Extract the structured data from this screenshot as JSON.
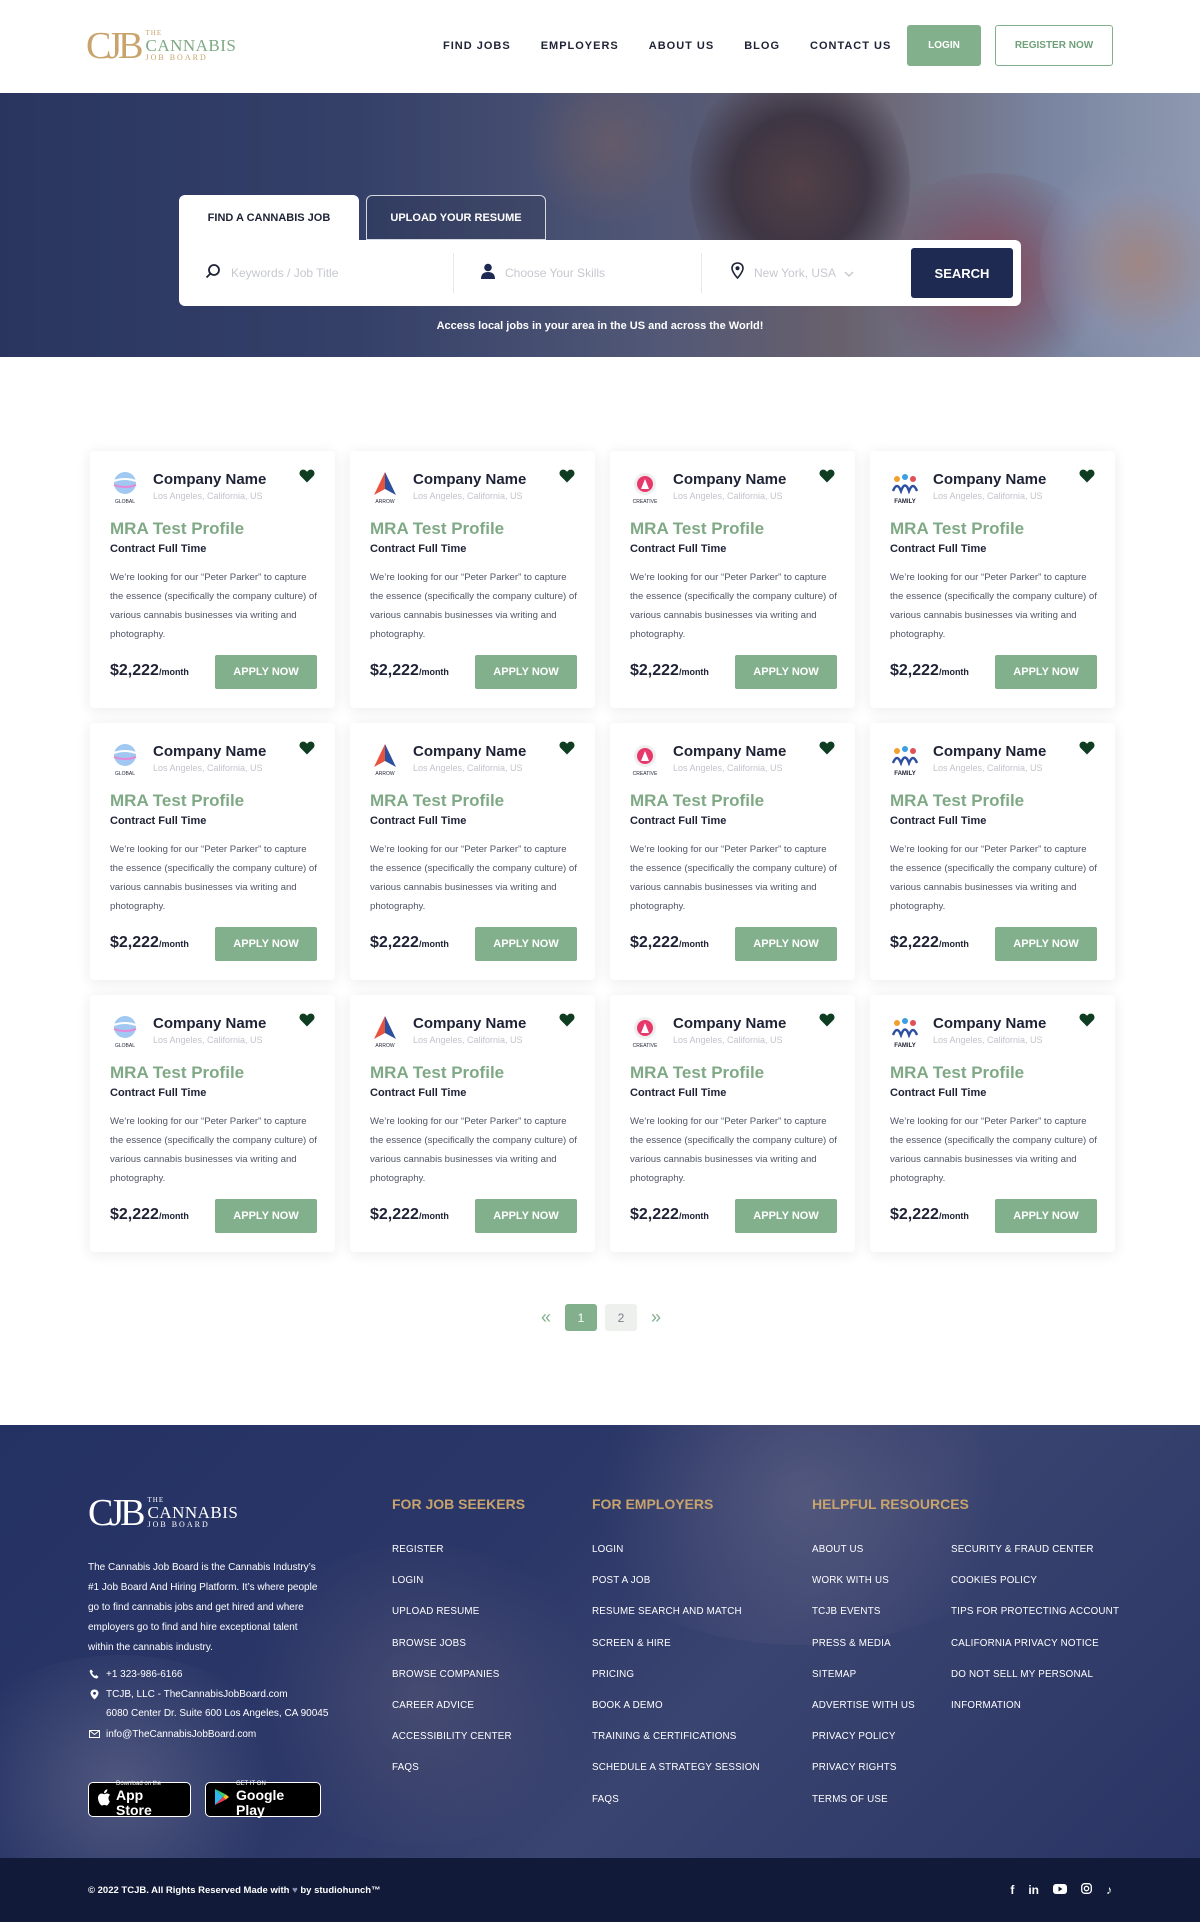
{
  "brand": {
    "mark": "CJB",
    "the": "THE",
    "name": "CANNABIS",
    "sub": "JOB BOARD"
  },
  "nav": {
    "items": [
      {
        "label": "FIND JOBS"
      },
      {
        "label": "EMPLOYERS"
      },
      {
        "label": "ABOUT US"
      },
      {
        "label": "BLOG"
      },
      {
        "label": "CONTACT US"
      }
    ],
    "login": "LOGIN",
    "register": "REGISTER NOW"
  },
  "hero": {
    "tabs": {
      "find": "FIND A CANNABIS JOB",
      "upload": "UPLOAD YOUR RESUME"
    },
    "search": {
      "keywords_placeholder": "Keywords / Job Title",
      "skills_placeholder": "Choose Your Skills",
      "location_placeholder": "New York, USA",
      "button": "SEARCH"
    },
    "caption": "Access local jobs in your area in the US and across the World!"
  },
  "jobs": [
    {
      "company": "Company Name",
      "location": "Los Angeles, California, US",
      "logo": "GLOBAL",
      "title": "MRA Test Profile",
      "type": "Contract Full Time",
      "desc": "We’re looking for our “Peter Parker” to capture the essence (specifically the company culture) of various cannabis businesses via writing and photography.",
      "price": "$2,222",
      "per": "/month",
      "apply": "APPLY NOW"
    },
    {
      "company": "Company Name",
      "location": "Los Angeles, California, US",
      "logo": "ARROW",
      "title": "MRA Test Profile",
      "type": "Contract Full Time",
      "desc": "We’re looking for our “Peter Parker” to capture the essence (specifically the company culture) of various cannabis businesses via writing and photography.",
      "price": "$2,222",
      "per": "/month",
      "apply": "APPLY NOW"
    },
    {
      "company": "Company Name",
      "location": "Los Angeles, California, US",
      "logo": "CREATIVE",
      "title": "MRA Test Profile",
      "type": "Contract Full Time",
      "desc": "We’re looking for our “Peter Parker” to capture the essence (specifically the company culture) of various cannabis businesses via writing and photography.",
      "price": "$2,222",
      "per": "/month",
      "apply": "APPLY NOW"
    },
    {
      "company": "Company Name",
      "location": "Los Angeles, California, US",
      "logo": "FAMILY",
      "title": "MRA Test Profile",
      "type": "Contract Full Time",
      "desc": "We’re looking for our “Peter Parker” to capture the essence (specifically the company culture) of various cannabis businesses via writing and photography.",
      "price": "$2,222",
      "per": "/month",
      "apply": "APPLY NOW"
    },
    {
      "company": "Company Name",
      "location": "Los Angeles, California, US",
      "logo": "GLOBAL",
      "title": "MRA Test Profile",
      "type": "Contract Full Time",
      "desc": "We’re looking for our “Peter Parker” to capture the essence (specifically the company culture) of various cannabis businesses via writing and photography.",
      "price": "$2,222",
      "per": "/month",
      "apply": "APPLY NOW"
    },
    {
      "company": "Company Name",
      "location": "Los Angeles, California, US",
      "logo": "ARROW",
      "title": "MRA Test Profile",
      "type": "Contract Full Time",
      "desc": "We’re looking for our “Peter Parker” to capture the essence (specifically the company culture) of various cannabis businesses via writing and photography.",
      "price": "$2,222",
      "per": "/month",
      "apply": "APPLY NOW"
    },
    {
      "company": "Company Name",
      "location": "Los Angeles, California, US",
      "logo": "CREATIVE",
      "title": "MRA Test Profile",
      "type": "Contract Full Time",
      "desc": "We’re looking for our “Peter Parker” to capture the essence (specifically the company culture) of various cannabis businesses via writing and photography.",
      "price": "$2,222",
      "per": "/month",
      "apply": "APPLY NOW"
    },
    {
      "company": "Company Name",
      "location": "Los Angeles, California, US",
      "logo": "FAMILY",
      "title": "MRA Test Profile",
      "type": "Contract Full Time",
      "desc": "We’re looking for our “Peter Parker” to capture the essence (specifically the company culture) of various cannabis businesses via writing and photography.",
      "price": "$2,222",
      "per": "/month",
      "apply": "APPLY NOW"
    },
    {
      "company": "Company Name",
      "location": "Los Angeles, California, US",
      "logo": "GLOBAL",
      "title": "MRA Test Profile",
      "type": "Contract Full Time",
      "desc": "We’re looking for our “Peter Parker” to capture the essence (specifically the company culture) of various cannabis businesses via writing and photography.",
      "price": "$2,222",
      "per": "/month",
      "apply": "APPLY NOW"
    },
    {
      "company": "Company Name",
      "location": "Los Angeles, California, US",
      "logo": "ARROW",
      "title": "MRA Test Profile",
      "type": "Contract Full Time",
      "desc": "We’re looking for our “Peter Parker” to capture the essence (specifically the company culture) of various cannabis businesses via writing and photography.",
      "price": "$2,222",
      "per": "/month",
      "apply": "APPLY NOW"
    },
    {
      "company": "Company Name",
      "location": "Los Angeles, California, US",
      "logo": "CREATIVE",
      "title": "MRA Test Profile",
      "type": "Contract Full Time",
      "desc": "We’re looking for our “Peter Parker” to capture the essence (specifically the company culture) of various cannabis businesses via writing and photography.",
      "price": "$2,222",
      "per": "/month",
      "apply": "APPLY NOW"
    },
    {
      "company": "Company Name",
      "location": "Los Angeles, California, US",
      "logo": "FAMILY",
      "title": "MRA Test Profile",
      "type": "Contract Full Time",
      "desc": "We’re looking for our “Peter Parker” to capture the essence (specifically the company culture) of various cannabis businesses via writing and photography.",
      "price": "$2,222",
      "per": "/month",
      "apply": "APPLY NOW"
    }
  ],
  "pagination": {
    "pages": [
      "1",
      "2"
    ],
    "current": "1"
  },
  "footer": {
    "about": "The Cannabis Job Board is the Cannabis Industry’s #1 Job Board And Hiring Platform. It’s where people go to find cannabis jobs and get hired and where employers go to find and hire exceptional talent within the cannabis industry.",
    "phone": "+1 323-986-6166",
    "address1": "TCJB, LLC - TheCannabisJobBoard.com",
    "address2": "6080 Center Dr. Suite 600  Los Angeles, CA 90045",
    "email": "info@TheCannabisJobBoard.com",
    "appstore": {
      "small": "Download on the",
      "big": "App Store"
    },
    "googleplay": {
      "small": "GET IT ON",
      "big": "Google Play"
    },
    "seekers": {
      "title": "FOR JOB SEEKERS",
      "links": [
        "REGISTER",
        "LOGIN",
        "UPLOAD RESUME",
        "BROWSE JOBS",
        "BROWSE COMPANIES",
        "CAREER ADVICE",
        "ACCESSIBILITY CENTER",
        "FAQS"
      ]
    },
    "employers": {
      "title": "FOR EMPLOYERS",
      "links": [
        "LOGIN",
        "POST A JOB",
        "RESUME SEARCH AND MATCH",
        "SCREEN & HIRE",
        "PRICING",
        "BOOK A DEMO",
        "TRAINING & CERTIFICATIONS",
        "SCHEDULE A STRATEGY SESSION",
        "FAQS"
      ]
    },
    "resources": {
      "title": "HELPFUL RESOURCES",
      "col1": [
        "ABOUT US",
        "WORK WITH US",
        "TCJB EVENTS",
        "PRESS & MEDIA",
        "SITEMAP",
        "ADVERTISE WITH US",
        "PRIVACY POLICY",
        "PRIVACY RIGHTS",
        "TERMS OF USE"
      ],
      "col2": [
        "SECURITY & FRAUD CENTER",
        "COOKIES POLICY",
        "TIPS FOR PROTECTING ACCOUNT",
        "CALIFORNIA PRIVACY NOTICE",
        "DO NOT SELL MY PERSONAL",
        "INFORMATION"
      ]
    },
    "copyright_left": "© 2022 TCJB. All Rights Reserved Made with",
    "copyright_right": "by studiohunch™",
    "socials": [
      "facebook-icon",
      "linkedin-icon",
      "youtube-icon",
      "instagram-icon",
      "tiktok-icon"
    ]
  },
  "colors": {
    "accent": "#82b08c",
    "navy": "#1e2a52",
    "gold": "#c8a36b",
    "heart": "#0f3d22"
  }
}
